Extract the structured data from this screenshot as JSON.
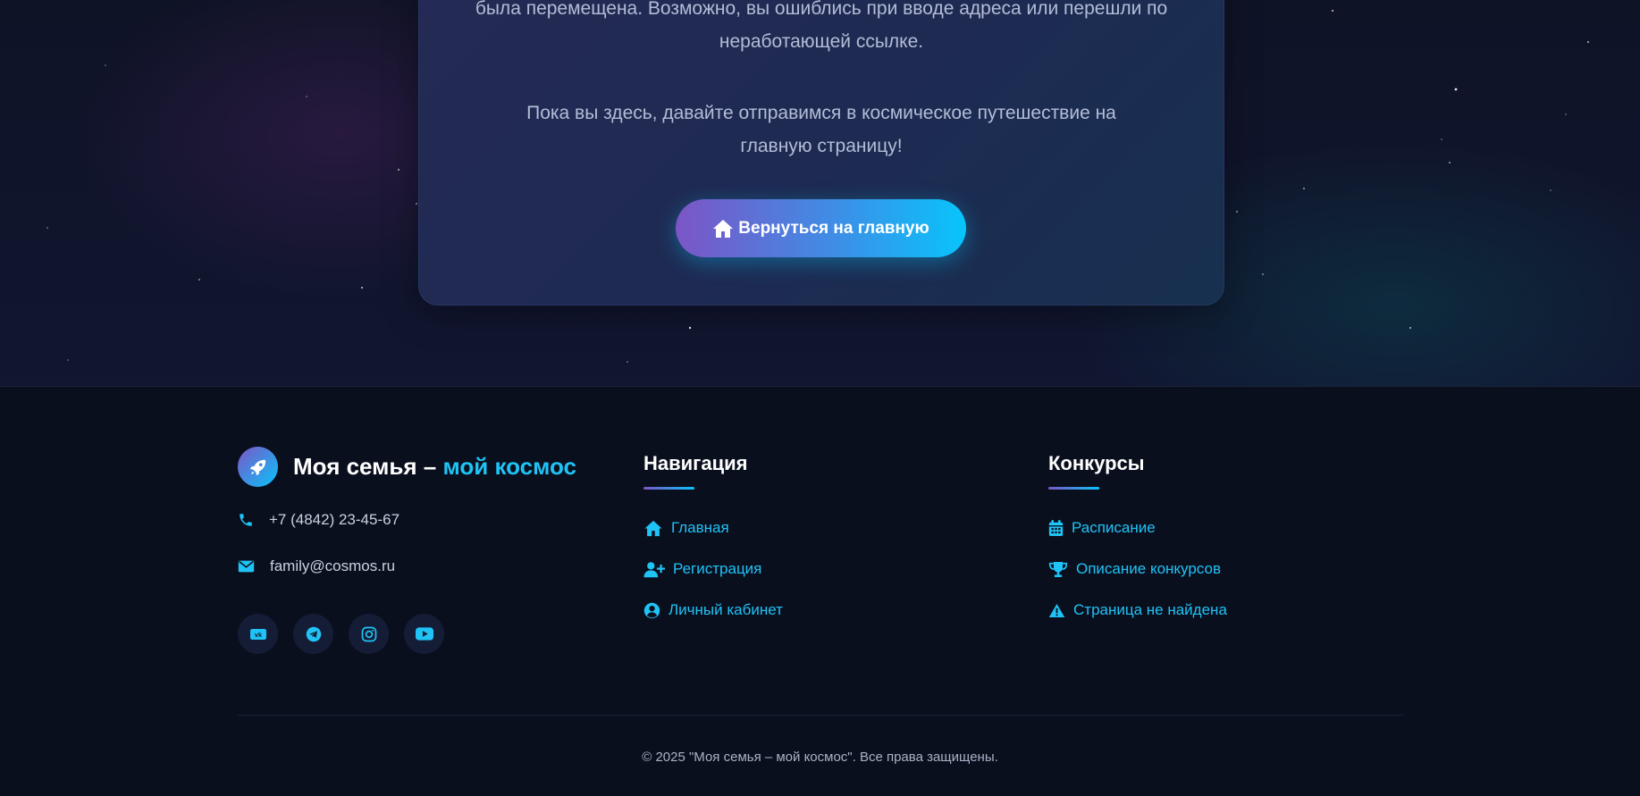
{
  "error_card": {
    "message_line": "была перемещена. Возможно, вы ошиблись при вводе адреса или перешли по неработающей ссылке.",
    "invite": "Пока вы здесь, давайте отправимся в космическое путешествие на главную страницу!",
    "home_button_label": "Вернуться на главную",
    "home_button_icon": "home-icon"
  },
  "footer": {
    "brand": {
      "title_part1": "Моя семья – ",
      "title_part2": "мой космос",
      "logo_icon": "rocket-icon"
    },
    "contacts": {
      "phone": "+7 (4842) 23-45-67",
      "email": "family@cosmos.ru"
    },
    "social": [
      {
        "icon": "vk-icon"
      },
      {
        "icon": "telegram-icon"
      },
      {
        "icon": "instagram-icon"
      },
      {
        "icon": "youtube-icon"
      }
    ],
    "navigation": {
      "title": "Навигация",
      "items": [
        {
          "label": "Главная",
          "icon": "home-icon"
        },
        {
          "label": "Регистрация",
          "icon": "user-plus-icon"
        },
        {
          "label": "Личный кабинет",
          "icon": "user-circle-icon"
        }
      ]
    },
    "contests": {
      "title": "Конкурсы",
      "items": [
        {
          "label": "Расписание",
          "icon": "calendar-icon"
        },
        {
          "label": "Описание конкурсов",
          "icon": "trophy-icon"
        },
        {
          "label": "Страница не найдена",
          "icon": "warning-icon"
        }
      ]
    },
    "copyright": "© 2025 \"Моя семья – мой космос\". Все права защищены."
  },
  "colors": {
    "accent": "#1fc3f5",
    "gradient_start": "#7c55c6",
    "gradient_end": "#08c4fb",
    "background": "#0a0f1e"
  }
}
